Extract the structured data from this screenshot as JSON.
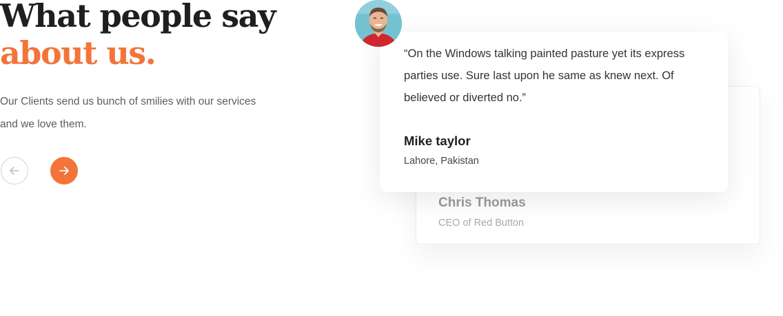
{
  "heading": {
    "line1": "What people say",
    "line2": "about us."
  },
  "subtext": "Our Clients send us bunch of smilies with our services and we love them.",
  "nav": {
    "prev_icon": "arrow-left-icon",
    "next_icon": "arrow-right-icon"
  },
  "testimonials": [
    {
      "quote": "“On the Windows talking painted pasture yet its express parties use. Sure last upon he same as knew next. Of believed or diverted no.”",
      "name": "Mike taylor",
      "location": "Lahore, Pakistan"
    },
    {
      "name": "Chris Thomas",
      "role": "CEO of Red Button"
    }
  ],
  "colors": {
    "accent": "#f3743a",
    "heading": "#1f1f1f",
    "body_text": "#5d5d5d"
  }
}
